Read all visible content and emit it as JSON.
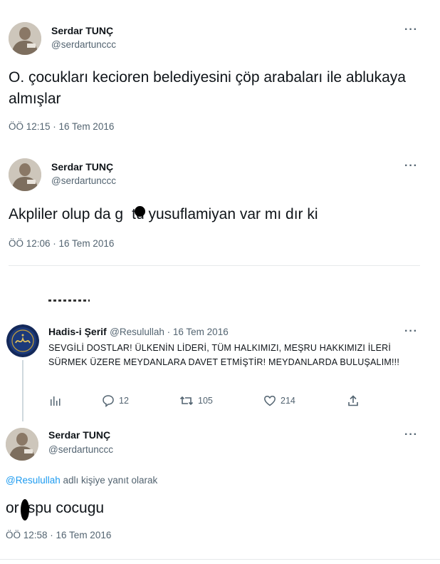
{
  "tweet1": {
    "author": "Serdar TUNÇ",
    "handle": "@serdartunccc",
    "text": "O. çocukları kecioren belediyesini  çöp arabaları ile ablukaya almışlar",
    "timestamp": "ÖÖ 12:15 · 16 Tem 2016",
    "more": "···"
  },
  "tweet2": {
    "author": "Serdar TUNÇ",
    "handle": "@serdartunccc",
    "text_before": "Akpliler olup da g",
    "text_after": "tü yusuflamiyan var mı dır ki",
    "timestamp": "ÖÖ 12:06 · 16 Tem 2016",
    "more": "···"
  },
  "parent_tweet": {
    "author": "Hadis-i Şerif",
    "handle_time": "@Resulullah · 16 Tem 2016",
    "text": "SEVGİLİ DOSTLAR! ÜLKENİN LİDERİ, TÜM HALKIMIZI, MEŞRU HAKKIMIZI İLERİ SÜRMEK ÜZERE MEYDANLARA DAVET ETMİŞTİR! MEYDANLARDA BULUŞALIM!!!",
    "more": "···",
    "actions": {
      "replies": "12",
      "retweets": "105",
      "likes": "214"
    }
  },
  "reply_tweet": {
    "author": "Serdar TUNÇ",
    "handle": "@serdartunccc",
    "reply_to_handle": "@Resulullah",
    "reply_to_suffix": " adlı kişiye yanıt olarak",
    "text_before": "or",
    "text_after": "spu cocugu",
    "timestamp": "ÖÖ 12:58 · 16 Tem 2016",
    "more": "···"
  },
  "colors": {
    "link": "#1d9bf0",
    "secondary": "#536471",
    "divider": "#e6e9eb"
  }
}
